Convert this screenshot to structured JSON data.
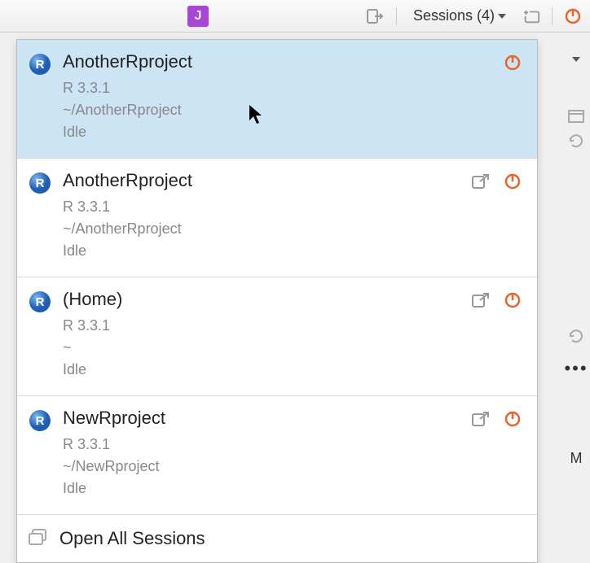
{
  "toolbar": {
    "user_initial": "J",
    "sessions_label": "Sessions (4)"
  },
  "sessions": [
    {
      "name": "AnotherRproject",
      "version": "R 3.3.1",
      "path": "~/AnotherRproject",
      "status": "Idle",
      "selected": true,
      "show_popout": false
    },
    {
      "name": "AnotherRproject",
      "version": "R 3.3.1",
      "path": "~/AnotherRproject",
      "status": "Idle",
      "selected": false,
      "show_popout": true
    },
    {
      "name": "(Home)",
      "version": "R 3.3.1",
      "path": "~",
      "status": "Idle",
      "selected": false,
      "show_popout": true
    },
    {
      "name": "NewRproject",
      "version": "R 3.3.1",
      "path": "~/NewRproject",
      "status": "Idle",
      "selected": false,
      "show_popout": true
    }
  ],
  "open_all_label": "Open All Sessions",
  "bg": {
    "m": "M"
  }
}
